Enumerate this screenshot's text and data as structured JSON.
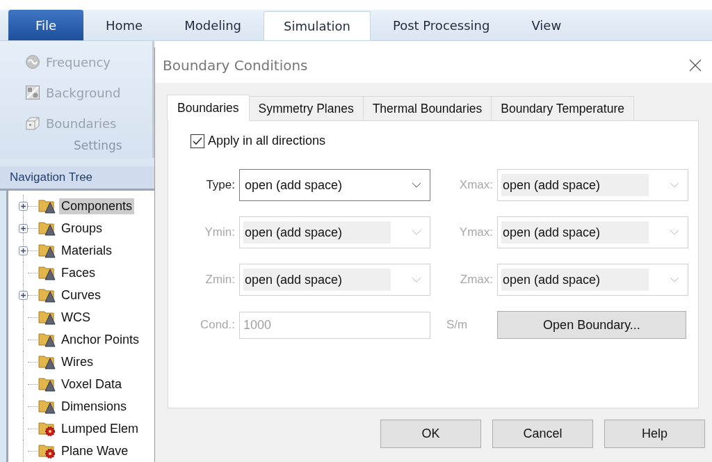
{
  "ribbon_tabs": [
    {
      "label": "File",
      "kind": "file",
      "selected": false
    },
    {
      "label": "Home",
      "kind": "tab",
      "selected": false
    },
    {
      "label": "Modeling",
      "kind": "tab",
      "selected": false
    },
    {
      "label": "Simulation",
      "kind": "tab",
      "selected": true
    },
    {
      "label": "Post Processing",
      "kind": "tab",
      "selected": false
    },
    {
      "label": "View",
      "kind": "tab",
      "selected": false
    }
  ],
  "ribbon_group": {
    "items": [
      {
        "label": "Frequency",
        "kind": "frequency",
        "disabled": true
      },
      {
        "label": "Background",
        "kind": "background",
        "disabled": true
      },
      {
        "label": "Boundaries",
        "kind": "boundaries",
        "disabled": true
      }
    ],
    "label": "Settings"
  },
  "navigation_tree": {
    "title": "Navigation Tree",
    "items": [
      {
        "label": "Components",
        "kind": "folder",
        "expandable": true,
        "selected": true
      },
      {
        "label": "Groups",
        "kind": "folder",
        "expandable": true,
        "selected": false
      },
      {
        "label": "Materials",
        "kind": "folder",
        "expandable": true,
        "selected": false
      },
      {
        "label": "Faces",
        "kind": "folder",
        "expandable": false,
        "selected": false
      },
      {
        "label": "Curves",
        "kind": "folder",
        "expandable": true,
        "selected": false
      },
      {
        "label": "WCS",
        "kind": "folder",
        "expandable": false,
        "selected": false
      },
      {
        "label": "Anchor Points",
        "kind": "folder",
        "expandable": false,
        "selected": false
      },
      {
        "label": "Wires",
        "kind": "folder",
        "expandable": false,
        "selected": false
      },
      {
        "label": "Voxel Data",
        "kind": "folder",
        "expandable": false,
        "selected": false
      },
      {
        "label": "Dimensions",
        "kind": "folder",
        "expandable": false,
        "selected": false
      },
      {
        "label": "Lumped Elem",
        "kind": "source",
        "expandable": false,
        "selected": false
      },
      {
        "label": "Plane Wave",
        "kind": "source",
        "expandable": false,
        "selected": false
      }
    ]
  },
  "dialog": {
    "title": "Boundary Conditions",
    "tabs": [
      {
        "label": "Boundaries",
        "selected": true
      },
      {
        "label": "Symmetry Planes",
        "selected": false
      },
      {
        "label": "Thermal Boundaries",
        "selected": false
      },
      {
        "label": "Boundary Temperature",
        "selected": false
      }
    ],
    "apply_all": {
      "label": "Apply in all directions",
      "checked": true
    },
    "fields": [
      {
        "label": "Type:",
        "kind": "dropdown",
        "value": "open (add space)",
        "disabled": false
      },
      {
        "label": "Xmax:",
        "kind": "dropdown",
        "value": "open (add space)",
        "disabled": true
      },
      {
        "label": "Ymin:",
        "kind": "dropdown",
        "value": "open (add space)",
        "disabled": true
      },
      {
        "label": "Ymax:",
        "kind": "dropdown",
        "value": "open (add space)",
        "disabled": true
      },
      {
        "label": "Zmin:",
        "kind": "dropdown",
        "value": "open (add space)",
        "disabled": true
      },
      {
        "label": "Zmax:",
        "kind": "dropdown",
        "value": "open (add space)",
        "disabled": true
      },
      {
        "label": "Cond.:",
        "kind": "text",
        "value": "1000",
        "unit": "S/m",
        "disabled": true
      },
      {
        "label": "Open Boundary...",
        "kind": "button"
      }
    ],
    "buttons": [
      "OK",
      "Cancel",
      "Help"
    ]
  }
}
